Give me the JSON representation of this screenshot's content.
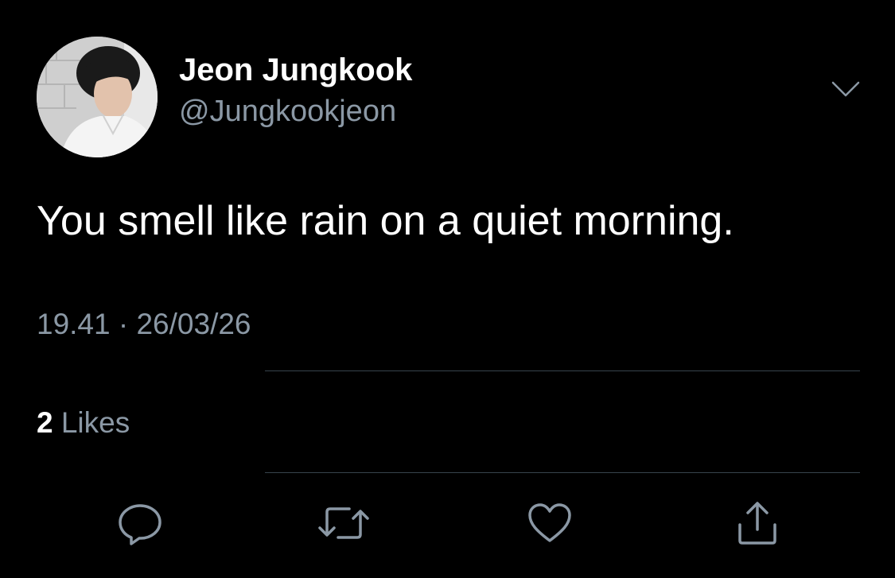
{
  "user": {
    "display_name": "Jeon Jungkook",
    "handle": "@Jungkookjeon"
  },
  "tweet": {
    "text": "You smell like rain on a quiet morning.",
    "time": "19.41",
    "separator": "·",
    "date": "26/03/26"
  },
  "stats": {
    "likes_count": "2",
    "likes_label": "Likes"
  },
  "icons": {
    "more": "chevron-down-icon",
    "reply": "reply-icon",
    "retweet": "retweet-icon",
    "like": "heart-icon",
    "share": "share-icon"
  },
  "colors": {
    "background": "#000000",
    "text": "#ffffff",
    "secondary": "#8b98a5",
    "divider": "#38444d"
  }
}
